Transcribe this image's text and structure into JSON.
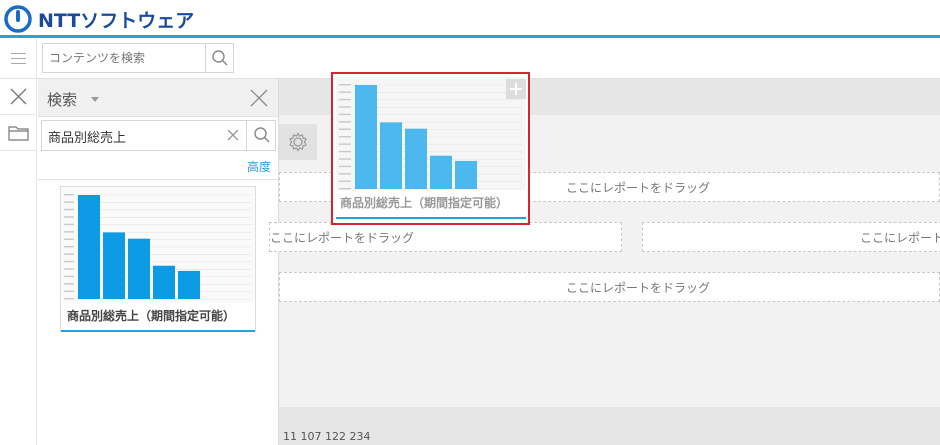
{
  "header": {
    "logo_text": "NTTソフトウェア",
    "brand_color": "#1a4a9a",
    "accent_color": "#2a9fd8"
  },
  "toolbar": {
    "menu_icon": "hamburger-icon",
    "search_placeholder": "コンテンツを検索",
    "search_icon": "search-icon"
  },
  "rail": {
    "items": [
      {
        "icon": "close-icon"
      },
      {
        "icon": "folder-icon"
      }
    ]
  },
  "search_panel": {
    "title": "検索",
    "query": "商品別総売上",
    "advanced_label": "高度",
    "result": {
      "title": "商品別総売上（期間指定可能）",
      "thumbnail_icon": "bar-chart-thumbnail"
    }
  },
  "canvas": {
    "dropzones": [
      {
        "label": "ここにレポートをドラッグ"
      },
      {
        "label": "ここにレポートをドラッグ"
      },
      {
        "label": "ここにレポートをドラッグ"
      },
      {
        "label": "ここにレポートをドラッグ"
      }
    ],
    "status_text": "11 107 122 234",
    "settings_icon": "gear-icon"
  },
  "drag_ghost": {
    "title": "商品別総売上（期間指定可能）",
    "plus_icon": "plus-icon",
    "border_color": "#d9232e"
  },
  "chart_data": {
    "type": "bar",
    "values": [
      1.0,
      0.64,
      0.58,
      0.32,
      0.27
    ],
    "bar_color_thumb": "#0e9be6",
    "bar_color_ghost": "#4db8ee"
  }
}
